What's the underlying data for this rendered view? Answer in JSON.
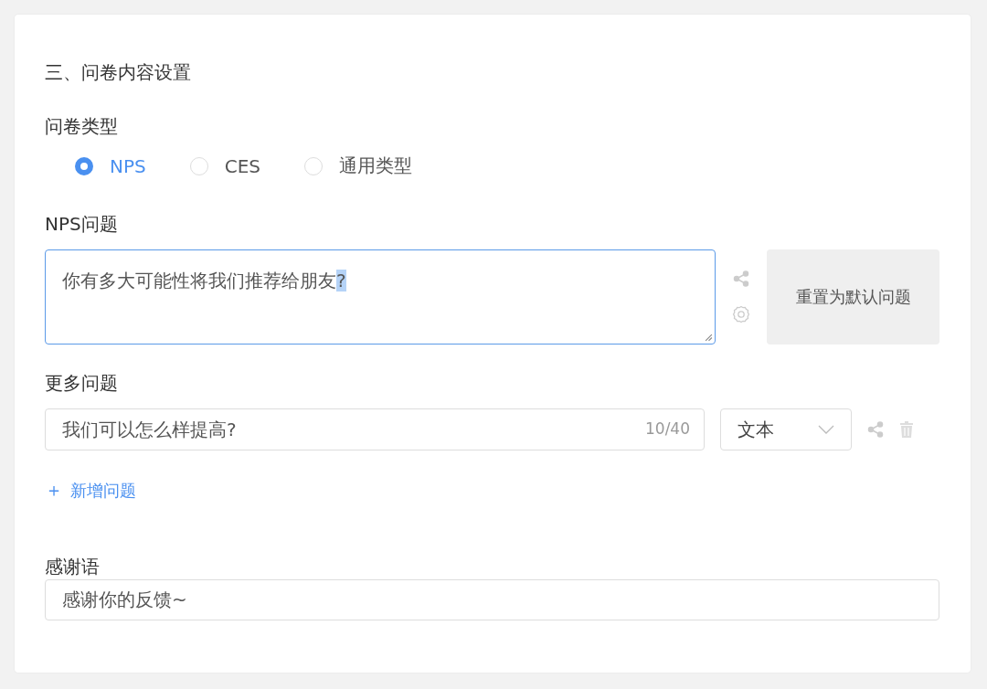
{
  "section_title": "三、问卷内容设置",
  "survey_type": {
    "label": "问卷类型",
    "options": [
      {
        "label": "NPS",
        "selected": true
      },
      {
        "label": "CES",
        "selected": false
      },
      {
        "label": "通用类型",
        "selected": false
      }
    ]
  },
  "nps_question": {
    "label": "NPS问题",
    "value": "你有多大可能性将我们推荐给朋友",
    "selected_text": "?",
    "reset_button": "重置为默认问题"
  },
  "more_questions": {
    "label": "更多问题",
    "items": [
      {
        "value": "我们可以怎么样提高?",
        "counter": "10/40",
        "type": "文本"
      }
    ],
    "add_button": "新增问题",
    "add_icon": "＋"
  },
  "thanks": {
    "label": "感谢语",
    "value": "感谢你的反馈~"
  }
}
